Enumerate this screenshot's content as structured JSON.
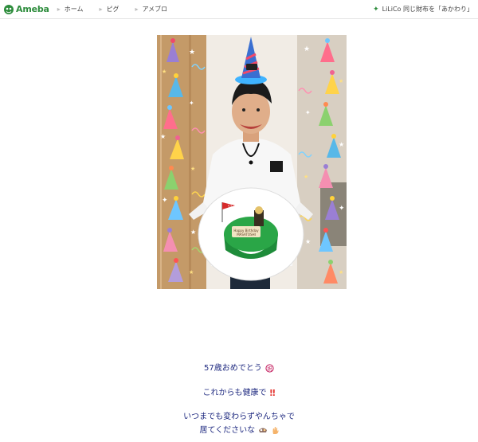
{
  "header": {
    "brand": "Ameba",
    "nav": [
      "ホーム",
      "ピグ",
      "アメブロ"
    ],
    "news": "LiLiCo 同じ財布を「あかわり」"
  },
  "post": {
    "lines": [
      "57歳おめでとう",
      "これからも健康で",
      "いつまでも変わらずやんちゃで",
      "居てくださいな"
    ],
    "cake_plate_text": [
      "Happy Birthday",
      "MASATOSHI"
    ],
    "cake_flag_text": "57"
  },
  "icons": {
    "logo": "ameba-logo-icon",
    "nav_chevron": "chevron-right-icon",
    "news_star": "sparkle-icon",
    "congrats": "congratulations-kanji-icon",
    "hearts": "double-exclamation-icon",
    "food": "bento-icon",
    "hand": "waving-hand-icon"
  },
  "colors": {
    "brand_green": "#2d8c3c",
    "text_navy": "#1f2a80"
  }
}
